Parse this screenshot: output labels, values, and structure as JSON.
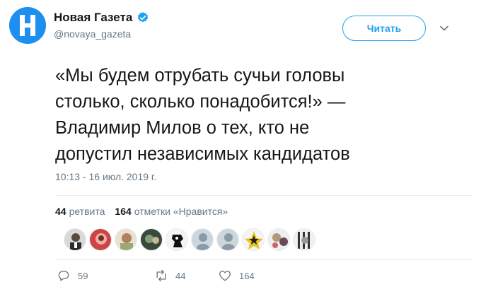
{
  "author": {
    "display_name": "Новая Газета",
    "handle": "@novaya_gazeta",
    "logo_letter": "Н",
    "verified_icon": "verified-badge-icon"
  },
  "header": {
    "follow_label": "Читать",
    "menu_icon": "chevron-down-icon"
  },
  "tweet": {
    "lines": [
      "«Мы будем отрубать сучьи головы",
      "столько, сколько понадобится!» —",
      "Владимир Милов о тех, кто не",
      "допустил независимых кандидатов"
    ],
    "timestamp": "10:13 - 16 июл. 2019 г."
  },
  "stats": {
    "retweets_count": "44",
    "retweets_label": "ретвита",
    "likes_count": "164",
    "likes_label": "отметки «Нравится»"
  },
  "likers": [
    {
      "icon": "user-avatar-1"
    },
    {
      "icon": "user-avatar-2"
    },
    {
      "icon": "user-avatar-3"
    },
    {
      "icon": "user-avatar-4"
    },
    {
      "icon": "user-avatar-5"
    },
    {
      "icon": "user-avatar-6"
    },
    {
      "icon": "user-avatar-7"
    },
    {
      "icon": "user-avatar-8"
    },
    {
      "icon": "user-avatar-9"
    }
  ],
  "actions": {
    "reply_count": "59",
    "retweet_count": "44",
    "like_count": "164"
  },
  "colors": {
    "accent": "#1da1f2",
    "brand_blue": "#1e8ff0",
    "muted": "#657786",
    "text": "#14171a"
  }
}
